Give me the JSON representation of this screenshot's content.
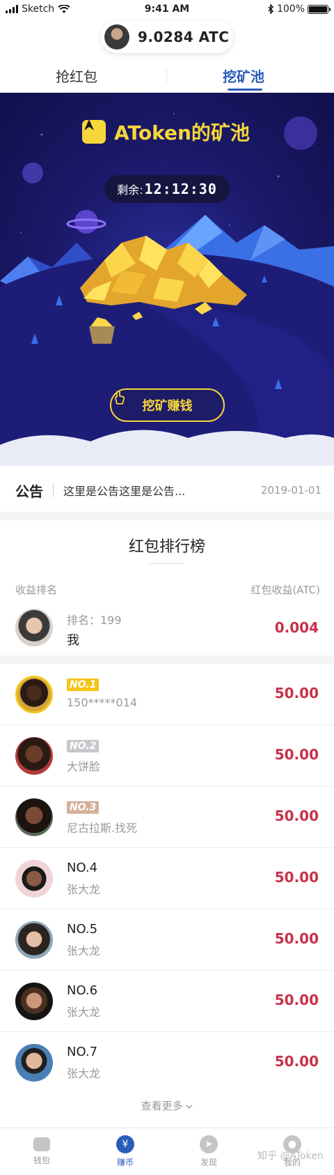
{
  "status_bar": {
    "carrier": "Sketch",
    "time": "9:41 AM",
    "battery": "100%",
    "battery_level": 1.0
  },
  "balance": {
    "amount": "9.0284 ATC"
  },
  "tabs": [
    {
      "label": "抢红包",
      "active": false
    },
    {
      "label": "挖矿池",
      "active": true
    }
  ],
  "hero": {
    "title": "AToken的矿池",
    "timer_label": "剩余:",
    "timer_value": "12:12:30",
    "button_label": "挖矿赚钱"
  },
  "notice": {
    "badge": "公告",
    "text": "这里是公告这里是公告...",
    "date": "2019-01-01"
  },
  "ranking": {
    "title": "红包排行榜",
    "col_left": "收益排名",
    "col_right": "红包收益(ATC)",
    "me": {
      "rank_label": "排名：199",
      "name": "我",
      "amount": "0.004"
    },
    "rows": [
      {
        "rank": "NO.1",
        "name": "150*****014",
        "amount": "50.00"
      },
      {
        "rank": "NO.2",
        "name": "大饼脸",
        "amount": "50.00"
      },
      {
        "rank": "NO.3",
        "name": "尼古拉斯.找死",
        "amount": "50.00"
      },
      {
        "rank": "NO.4",
        "name": "张大龙",
        "amount": "50.00"
      },
      {
        "rank": "NO.5",
        "name": "张大龙",
        "amount": "50.00"
      },
      {
        "rank": "NO.6",
        "name": "张大龙",
        "amount": "50.00"
      },
      {
        "rank": "NO.7",
        "name": "张大龙",
        "amount": "50.00"
      }
    ],
    "see_more": "查看更多"
  },
  "bottom_nav": [
    {
      "label": "钱包",
      "icon": "wallet-icon",
      "active": false
    },
    {
      "label": "赚币",
      "icon": "yen-icon",
      "active": true
    },
    {
      "label": "发现",
      "icon": "compass-icon",
      "active": false
    },
    {
      "label": "我的",
      "icon": "user-icon",
      "active": false
    }
  ],
  "watermark": "知乎 @AToken",
  "colors": {
    "accent_blue": "#2a5cb8",
    "gold": "#f7d63b",
    "amount_red": "#c8324a",
    "hero_bg": "#1c1b6e"
  }
}
